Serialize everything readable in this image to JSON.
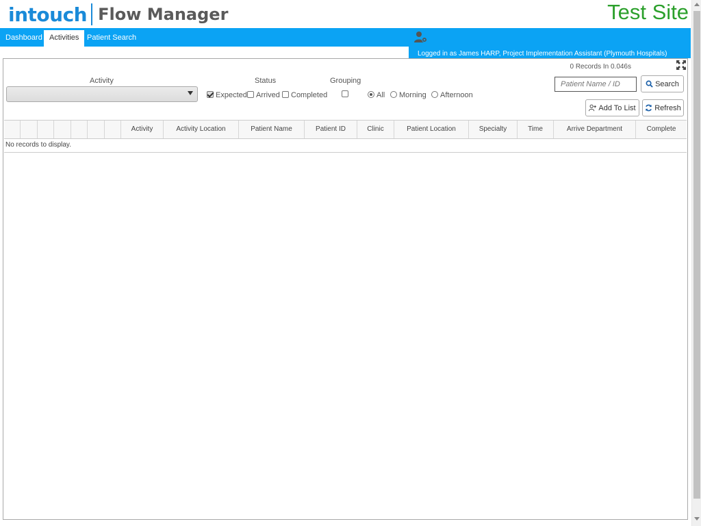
{
  "header": {
    "logo_intouch": "intouch",
    "logo_product": "Flow Manager",
    "site_label": "Test Site"
  },
  "nav": {
    "tabs": [
      {
        "label": "Dashboard",
        "active": false
      },
      {
        "label": "Activities",
        "active": true
      },
      {
        "label": "Patient Search",
        "active": false
      }
    ],
    "logged_in_text": "Logged in as James HARP, Project Implementation Assistant (Plymouth Hospitals)"
  },
  "filters": {
    "activity_label": "Activity",
    "activity_value": "",
    "status_label": "Status",
    "status_options": [
      {
        "label": "Expected",
        "checked": true
      },
      {
        "label": "Arrived",
        "checked": false
      },
      {
        "label": "Completed",
        "checked": false
      }
    ],
    "grouping_label": "Grouping",
    "grouping_checked": false,
    "period_options": [
      {
        "label": "All",
        "checked": true
      },
      {
        "label": "Morning",
        "checked": false
      },
      {
        "label": "Afternoon",
        "checked": false
      }
    ]
  },
  "toolbar": {
    "records_text": "0 Records In 0.046s",
    "search_placeholder": "Patient Name / ID",
    "search_label": "Search",
    "add_to_list_label": "Add To List",
    "refresh_label": "Refresh"
  },
  "table": {
    "columns": [
      "",
      "",
      "",
      "",
      "",
      "",
      "",
      "Activity",
      "Activity Location",
      "Patient Name",
      "Patient ID",
      "Clinic",
      "Patient Location",
      "Specialty",
      "Time",
      "Arrive Department",
      "Complete"
    ],
    "empty_text": "No records to display."
  },
  "colors": {
    "brand_blue": "#0ba3f4",
    "logo_blue": "#1a8ad8",
    "site_green": "#2ca02c"
  }
}
